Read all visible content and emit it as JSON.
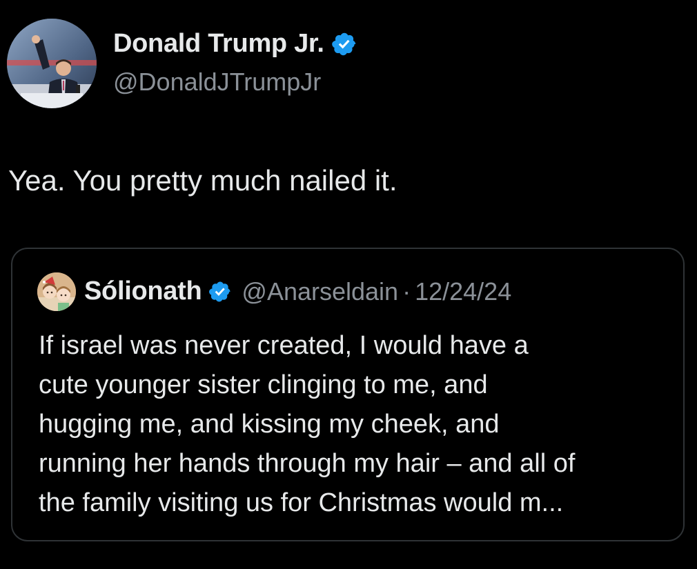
{
  "colors": {
    "background": "#000000",
    "text_primary": "#e7e9ea",
    "text_secondary": "#8b9198",
    "verified_badge": "#1d9bf0",
    "card_border": "#2f3336"
  },
  "tweet": {
    "author": {
      "display_name": "Donald Trump Jr.",
      "handle": "@DonaldJTrumpJr",
      "verified_icon": "verified-badge-icon"
    },
    "text": "Yea. You pretty much nailed it."
  },
  "quoted_tweet": {
    "author": {
      "display_name": "Sólionath",
      "handle": "@Anarseldain",
      "verified_icon": "verified-badge-icon"
    },
    "separator": "·",
    "date": "12/24/24",
    "text_lines": [
      "If israel was never created, I would have a",
      "cute younger sister clinging to me, and",
      "hugging me, and kissing my cheek, and",
      "running her hands through my hair – and all of",
      "the family visiting us for Christmas would m..."
    ]
  }
}
